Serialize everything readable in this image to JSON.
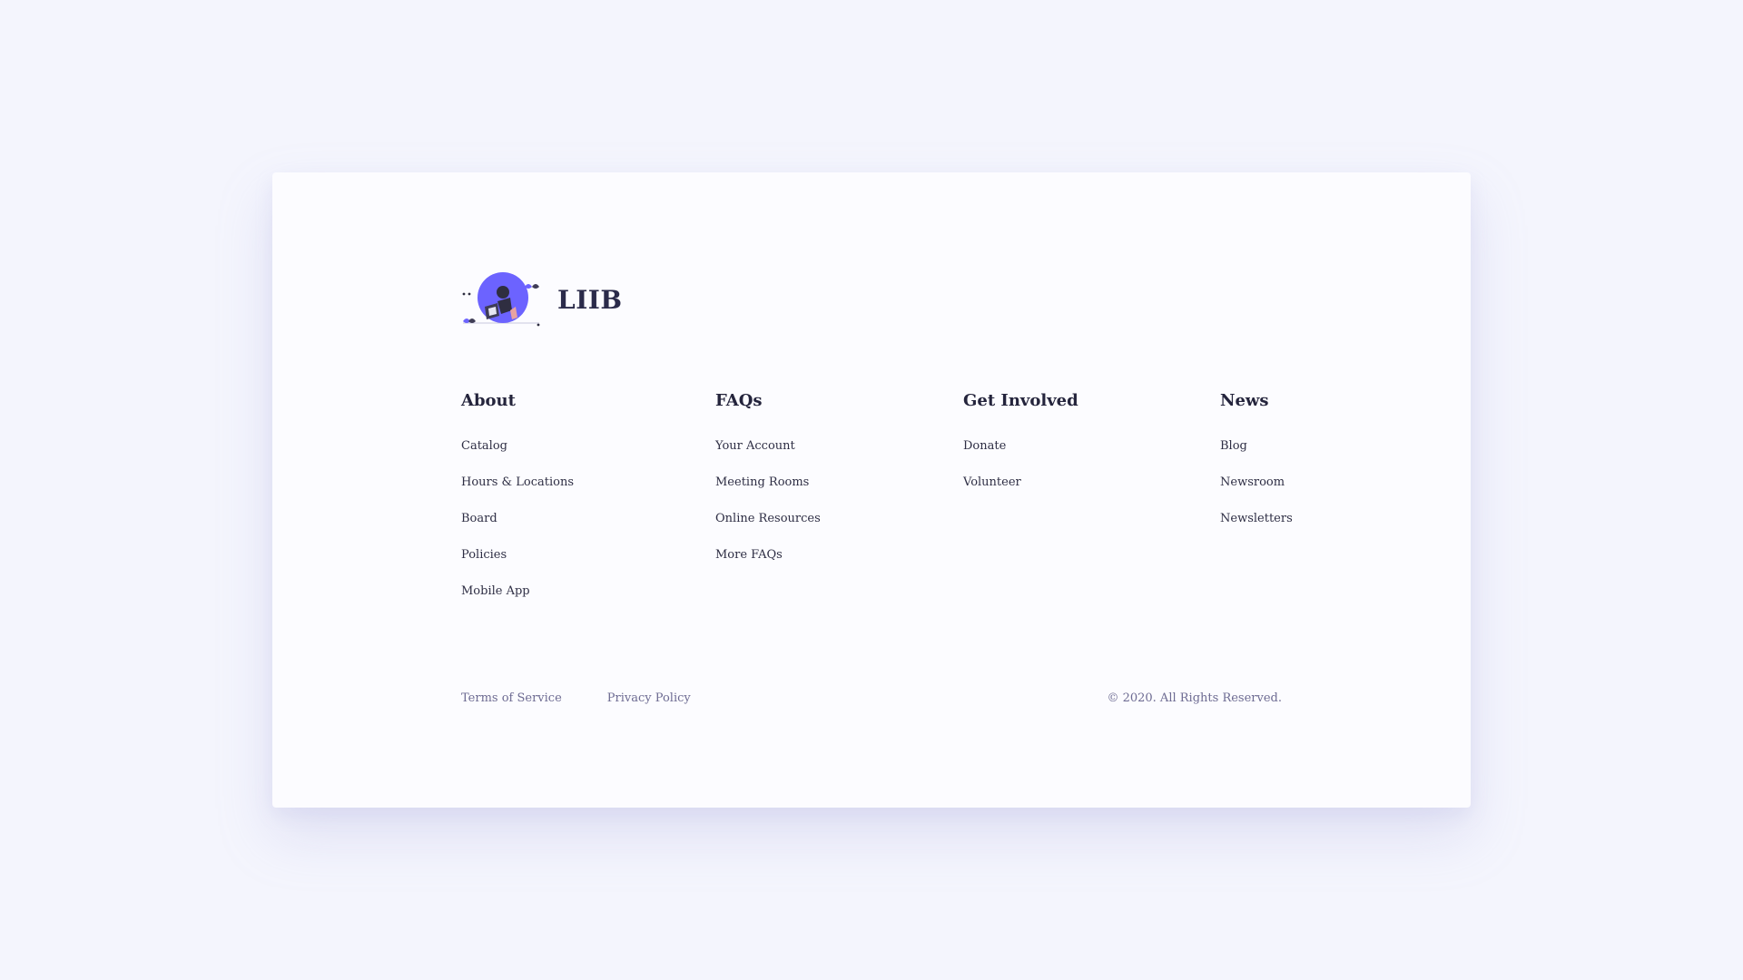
{
  "brand": {
    "name": "LIIB",
    "logo_icon": "reading-globe-logo-icon",
    "accent_color": "#6c63ff"
  },
  "columns": [
    {
      "heading": "About",
      "items": [
        "Catalog",
        "Hours & Locations",
        "Board",
        "Policies",
        "Mobile App"
      ]
    },
    {
      "heading": "FAQs",
      "items": [
        "Your Account",
        "Meeting Rooms",
        "Online Resources",
        "More FAQs"
      ]
    },
    {
      "heading": "Get Involved",
      "items": [
        "Donate",
        "Volunteer"
      ]
    },
    {
      "heading": "News",
      "items": [
        "Blog",
        "Newsroom",
        "Newsletters"
      ]
    }
  ],
  "footer": {
    "terms_label": "Terms of Service",
    "privacy_label": "Privacy Policy",
    "copyright": "© 2020. All Rights Reserved."
  }
}
